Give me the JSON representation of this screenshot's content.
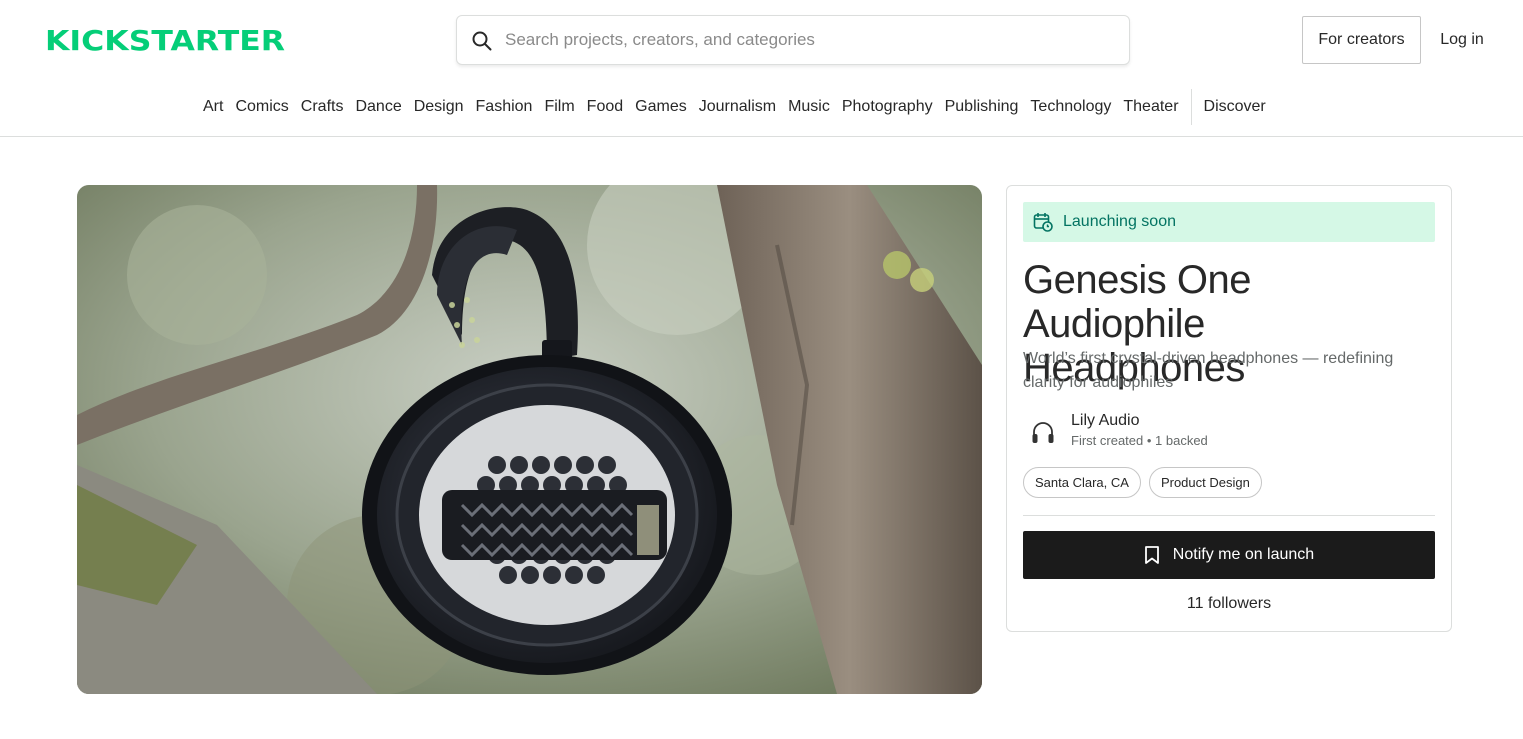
{
  "header": {
    "logo_text": "KICKSTARTER",
    "brand_color": "#05ce78",
    "search": {
      "placeholder": "Search projects, creators, and categories",
      "icon": "search-icon"
    },
    "for_creators_label": "For creators",
    "login_label": "Log in"
  },
  "categories": [
    "Art",
    "Comics",
    "Crafts",
    "Dance",
    "Design",
    "Fashion",
    "Film",
    "Food",
    "Games",
    "Journalism",
    "Music",
    "Photography",
    "Publishing",
    "Technology",
    "Theater"
  ],
  "discover_label": "Discover",
  "hero": {
    "image": "photo of black over-ear headphones hanging on a tree branch"
  },
  "project": {
    "status": {
      "label": "Launching soon",
      "icon": "calendar-clock-icon",
      "bg": "#d5f8e6",
      "color": "#037362"
    },
    "title": "Genesis One Audiophile Headphones",
    "subtitle": "World’s first crystal-driven headphones — redefining clarity for audiophiles",
    "creator": {
      "name": "Lily Audio",
      "meta": "First created • 1 backed",
      "avatar_icon": "headphones-icon"
    },
    "tags": [
      "Santa Clara, CA",
      "Product Design"
    ],
    "notify_label": "Notify me on launch",
    "notify_icon": "bookmark-icon",
    "followers": "11 followers"
  }
}
